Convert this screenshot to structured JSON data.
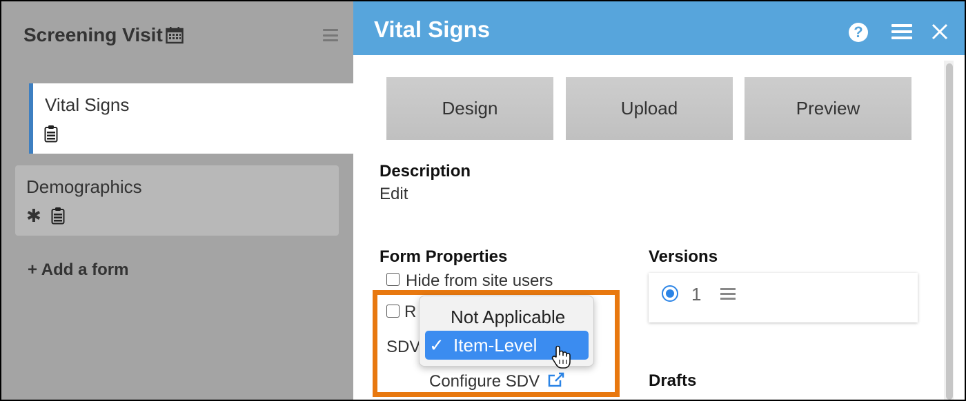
{
  "left_panel": {
    "visit_title": "Screening Visit",
    "forms": [
      {
        "name": "Vital Signs",
        "active": true
      },
      {
        "name": "Demographics",
        "active": false,
        "required_marker": "✱"
      }
    ],
    "add_form": "+ Add a form"
  },
  "right_panel": {
    "title": "Vital Signs",
    "header_icons": [
      "help-icon",
      "menu-icon",
      "close-icon"
    ],
    "tabs": [
      "Design",
      "Upload",
      "Preview"
    ],
    "description": {
      "label": "Description",
      "value": "Edit"
    },
    "form_properties": {
      "label": "Form Properties",
      "hide_from_site_users": "Hide from site users",
      "truncated_checkbox_label": "R",
      "sdv_label": "SDV",
      "configure_sdv": "Configure SDV"
    },
    "versions": {
      "label": "Versions",
      "items": [
        {
          "number": "1",
          "selected": true
        }
      ]
    },
    "drafts": {
      "label": "Drafts"
    }
  },
  "sdv_dropdown": {
    "options": [
      {
        "label": "Not Applicable",
        "selected": false
      },
      {
        "label": "Item-Level",
        "selected": true,
        "check": "✓"
      }
    ]
  },
  "colors": {
    "header": "#57a5dc",
    "active_border": "#3d7fc1",
    "highlight": "#e8780f",
    "selected_option": "#3b8cf0"
  }
}
